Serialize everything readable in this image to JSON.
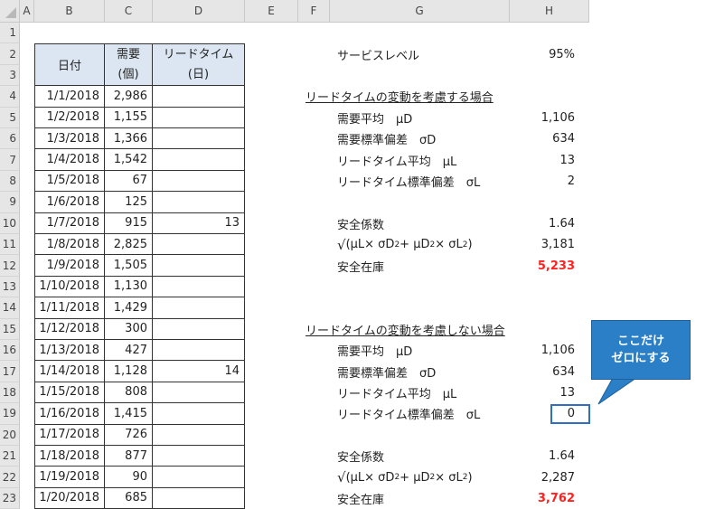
{
  "columns": [
    "A",
    "B",
    "C",
    "D",
    "E",
    "F",
    "G",
    "H"
  ],
  "rows": [
    "1",
    "2",
    "3",
    "4",
    "5",
    "6",
    "7",
    "8",
    "9",
    "10",
    "11",
    "12",
    "13",
    "14",
    "15",
    "16",
    "17",
    "18",
    "19",
    "20",
    "21",
    "22",
    "23"
  ],
  "table_header": {
    "date": "日付",
    "demand_top": "需要",
    "demand_unit": "(個)",
    "lead_top": "リードタイム",
    "lead_unit": "(日)"
  },
  "table_rows": [
    {
      "date": "1/1/2018",
      "demand": "2,986",
      "lead": ""
    },
    {
      "date": "1/2/2018",
      "demand": "1,155",
      "lead": ""
    },
    {
      "date": "1/3/2018",
      "demand": "1,366",
      "lead": ""
    },
    {
      "date": "1/4/2018",
      "demand": "1,542",
      "lead": ""
    },
    {
      "date": "1/5/2018",
      "demand": "67",
      "lead": ""
    },
    {
      "date": "1/6/2018",
      "demand": "125",
      "lead": ""
    },
    {
      "date": "1/7/2018",
      "demand": "915",
      "lead": "13"
    },
    {
      "date": "1/8/2018",
      "demand": "2,825",
      "lead": ""
    },
    {
      "date": "1/9/2018",
      "demand": "1,505",
      "lead": ""
    },
    {
      "date": "1/10/2018",
      "demand": "1,130",
      "lead": ""
    },
    {
      "date": "1/11/2018",
      "demand": "1,429",
      "lead": ""
    },
    {
      "date": "1/12/2018",
      "demand": "300",
      "lead": ""
    },
    {
      "date": "1/13/2018",
      "demand": "427",
      "lead": ""
    },
    {
      "date": "1/14/2018",
      "demand": "1,128",
      "lead": "14"
    },
    {
      "date": "1/15/2018",
      "demand": "808",
      "lead": ""
    },
    {
      "date": "1/16/2018",
      "demand": "1,415",
      "lead": ""
    },
    {
      "date": "1/17/2018",
      "demand": "726",
      "lead": ""
    },
    {
      "date": "1/18/2018",
      "demand": "877",
      "lead": ""
    },
    {
      "date": "1/19/2018",
      "demand": "90",
      "lead": ""
    },
    {
      "date": "1/20/2018",
      "demand": "685",
      "lead": ""
    }
  ],
  "service_level": {
    "label": "サービスレベル",
    "value": "95%"
  },
  "section1": {
    "title": "リードタイムの変動を考慮する場合",
    "items": [
      {
        "label": "需要平均　μD",
        "value": "1,106"
      },
      {
        "label": "需要標準偏差　σD",
        "value": "634"
      },
      {
        "label": "リードタイム平均　μL",
        "value": "13"
      },
      {
        "label": "リードタイム標準偏差　σL",
        "value": "2"
      }
    ],
    "safety_factor_label": "安全係数",
    "safety_factor_value": "1.64",
    "sqrt_value": "3,181",
    "safety_stock_label": "安全在庫",
    "safety_stock_value": "5,233"
  },
  "section2": {
    "title": "リードタイムの変動を考慮しない場合",
    "items": [
      {
        "label": "需要平均　μD",
        "value": "1,106"
      },
      {
        "label": "需要標準偏差　σD",
        "value": "634"
      },
      {
        "label": "リードタイム平均　μL",
        "value": "13"
      },
      {
        "label": "リードタイム標準偏差　σL",
        "value": "0"
      }
    ],
    "safety_factor_label": "安全係数",
    "safety_factor_value": "1.64",
    "sqrt_value": "2,287",
    "safety_stock_label": "安全在庫",
    "safety_stock_value": "3,762"
  },
  "formula": {
    "open": "(μL× σD",
    "mid": "+ μD",
    "close": "× σL",
    "end": ")",
    "sup": "2"
  },
  "callout": {
    "line1": "ここだけ",
    "line2": "ゼロにする"
  },
  "colors": {
    "header_fill": "#dce6f2",
    "accent_red": "#ff2020",
    "callout_blue": "#2a7fc7"
  }
}
